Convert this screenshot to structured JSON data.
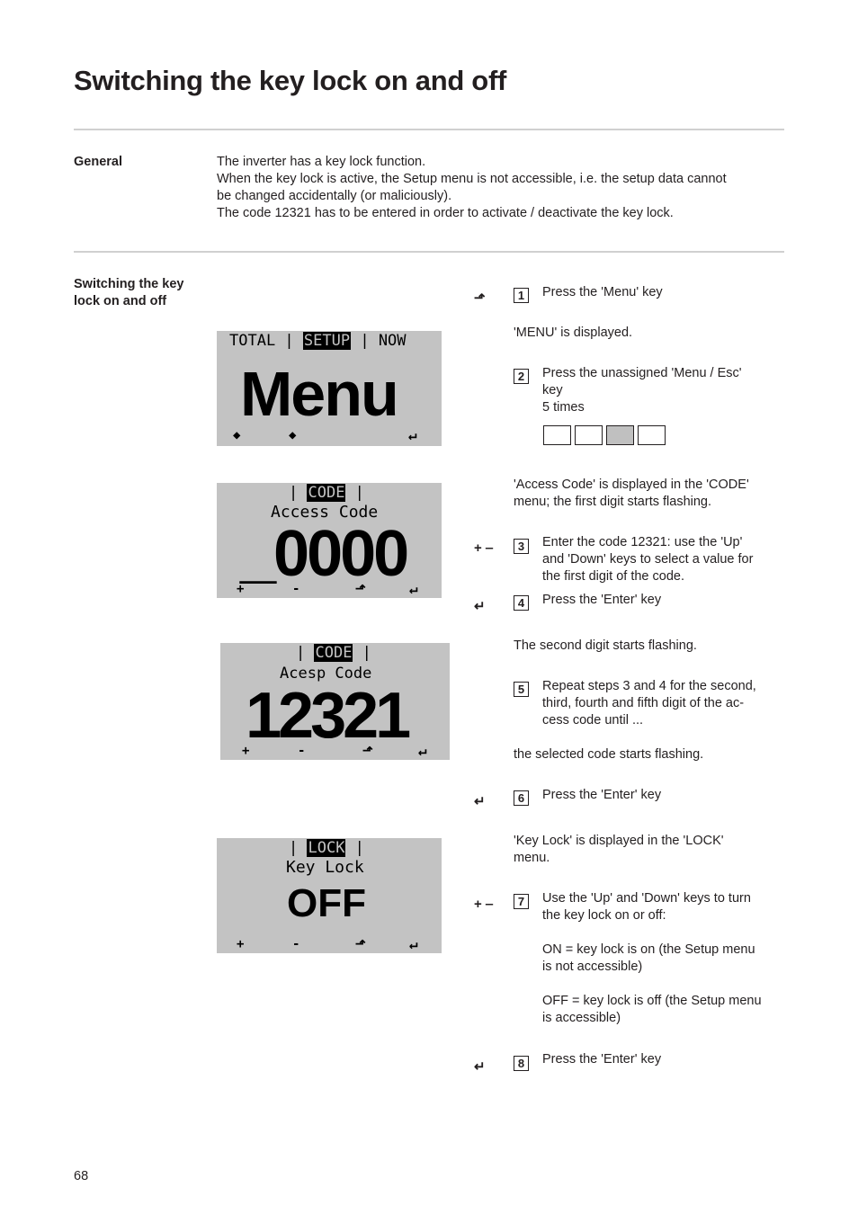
{
  "page": {
    "title": "Switching the key lock on and off",
    "page_number": "68"
  },
  "general": {
    "label": "General",
    "lines": [
      "The inverter has a key lock function.",
      "When the key lock is active, the Setup menu is not accessible, i.e. the setup data cannot",
      "be changed accidentally (or maliciously).",
      "The code 12321 has to be entered in order to activate / deactivate the key lock."
    ]
  },
  "procedure": {
    "label_line1": "Switching the key",
    "label_line2": "lock on and off",
    "steps": [
      {
        "num": "1",
        "icon": "menu-up-key",
        "glyph": "⬏",
        "text": "Press the 'Menu' key"
      },
      {
        "num": "2",
        "text_lines": [
          "Press the unassigned 'Menu / Esc'",
          "key",
          "5 times"
        ]
      },
      {
        "num": "3",
        "icon": "plus-minus-keys",
        "glyph": "+ ‒",
        "text_lines": [
          "Enter the code 12321: use the 'Up'",
          "and 'Down' keys to select a value for",
          "the first digit of the code."
        ]
      },
      {
        "num": "4",
        "icon": "enter-key",
        "glyph": "↵",
        "text": "Press the 'Enter' key"
      },
      {
        "num": "5",
        "text_lines": [
          "Repeat steps 3 and 4 for the second,",
          "third, fourth and fifth digit of the ac-",
          "cess code until ..."
        ]
      },
      {
        "num": "6",
        "icon": "enter-key",
        "glyph": "↵",
        "text": "Press the 'Enter' key"
      },
      {
        "num": "7",
        "icon": "plus-minus-keys",
        "glyph": "+ ‒",
        "text_lines": [
          "Use the 'Up' and 'Down' keys to turn",
          "the key lock on or off:"
        ],
        "on_lines": [
          "ON = key lock is on (the Setup menu",
          "is not accessible)"
        ],
        "off_lines": [
          "OFF = key lock is off (the Setup menu",
          "is accessible)"
        ]
      },
      {
        "num": "8",
        "icon": "enter-key",
        "glyph": "↵",
        "text": "Press the 'Enter' key"
      }
    ],
    "notes": {
      "menu_displayed": "'MENU' is displayed.",
      "access_code_1": "'Access Code' is displayed in the 'CODE'",
      "access_code_2": "menu; the first digit starts flashing.",
      "second_digit": "The second digit starts flashing.",
      "code_flashing": "the selected code starts flashing.",
      "key_lock_1": "'Key Lock' is displayed in the 'LOCK'",
      "key_lock_2": "menu."
    },
    "key_press_indicator": {
      "total": 4,
      "active_index": 2
    }
  },
  "lcd_screens": {
    "menu": {
      "tab_left": "TOTAL",
      "tab_active": "SETUP",
      "tab_right": "NOW",
      "main": "Menu",
      "keys": [
        "◆",
        "◆",
        "↵"
      ]
    },
    "code_entry": {
      "tab_active": "CODE",
      "label": "Access Code",
      "value": "_0000",
      "keys": [
        "+",
        "-",
        "⬏",
        "↵"
      ]
    },
    "code_done": {
      "tab_active": "CODE",
      "label": "Acesp Code",
      "value": "12321",
      "keys": [
        "+",
        "-",
        "⬏",
        "↵"
      ]
    },
    "lock": {
      "tab_active": "LOCK",
      "label": "Key Lock",
      "value": "OFF",
      "keys": [
        "+",
        "-",
        "⬏",
        "↵"
      ]
    }
  }
}
